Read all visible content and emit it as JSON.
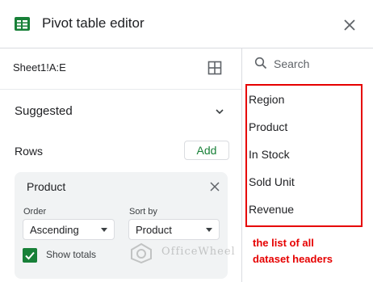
{
  "header": {
    "title": "Pivot table editor",
    "icon": "spreadsheet-icon",
    "close_icon": "close-icon"
  },
  "data_range": {
    "value": "Sheet1!A:E",
    "icon": "grid-icon"
  },
  "suggested": {
    "label": "Suggested",
    "icon": "chevron-down-icon"
  },
  "rows": {
    "label": "Rows",
    "add_label": "Add"
  },
  "row_card": {
    "title": "Product",
    "order_label": "Order",
    "order_value": "Ascending",
    "sort_by_label": "Sort by",
    "sort_by_value": "Product",
    "show_totals_label": "Show totals",
    "show_totals_checked": true
  },
  "search": {
    "placeholder": "Search"
  },
  "fields": [
    {
      "label": "Region"
    },
    {
      "label": "Product"
    },
    {
      "label": "In Stock"
    },
    {
      "label": "Sold Unit"
    },
    {
      "label": "Revenue"
    }
  ],
  "annotation": {
    "line1": "the list of all",
    "line2": "dataset headers"
  },
  "watermark": {
    "text": "OfficeWheel"
  },
  "colors": {
    "accent_green": "#188038",
    "annotation_red": "#e60000",
    "card_bg": "#f1f3f4"
  }
}
